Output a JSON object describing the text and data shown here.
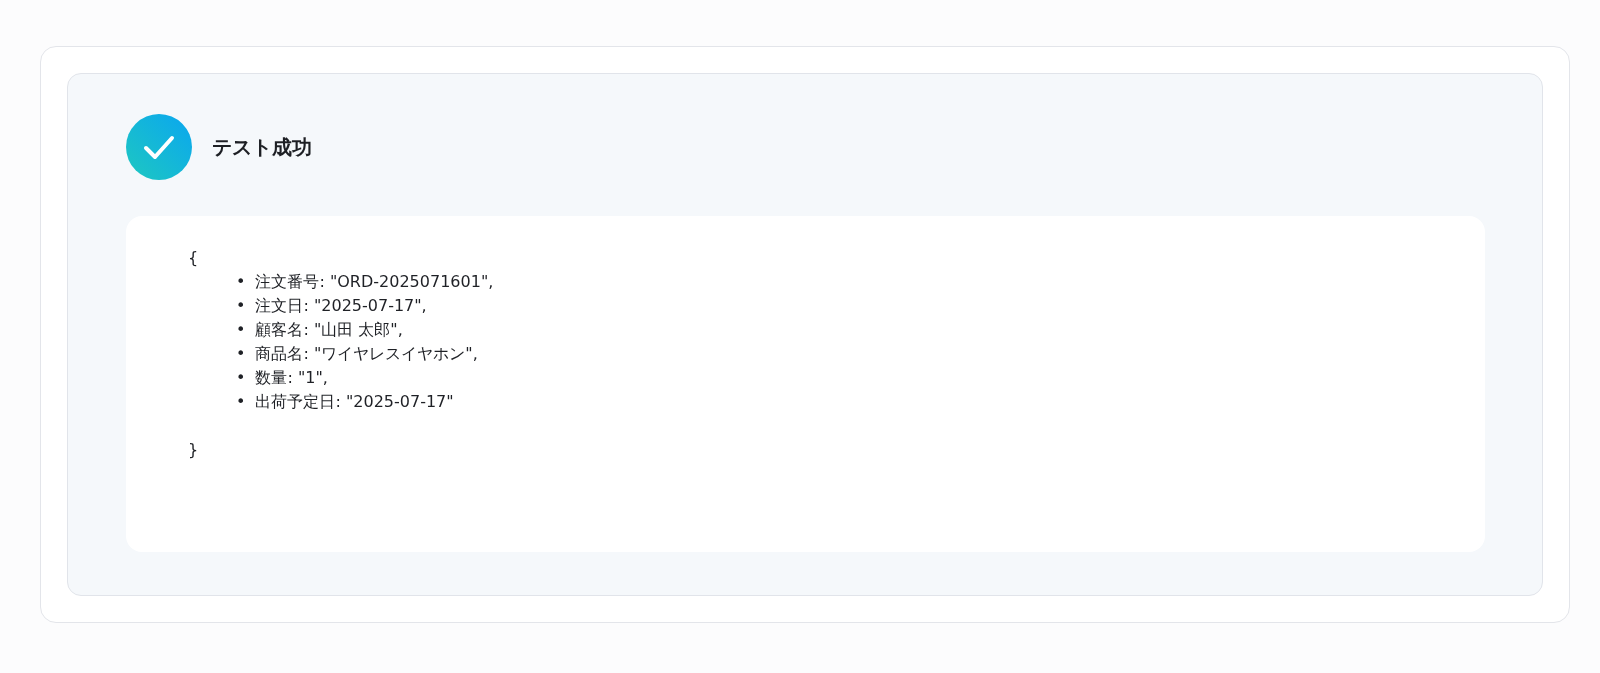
{
  "status": {
    "title": "テスト成功",
    "success": true
  },
  "result": {
    "open": "{",
    "bullet": "•",
    "items": [
      "注文番号: \"ORD-2025071601\",",
      "注文日: \"2025-07-17\",",
      "顧客名: \"山田 太郎\",",
      "商品名: \"ワイヤレスイヤホン\",",
      "数量: \"1\",",
      "出荷予定日: \"2025-07-17\""
    ],
    "close": "}"
  }
}
